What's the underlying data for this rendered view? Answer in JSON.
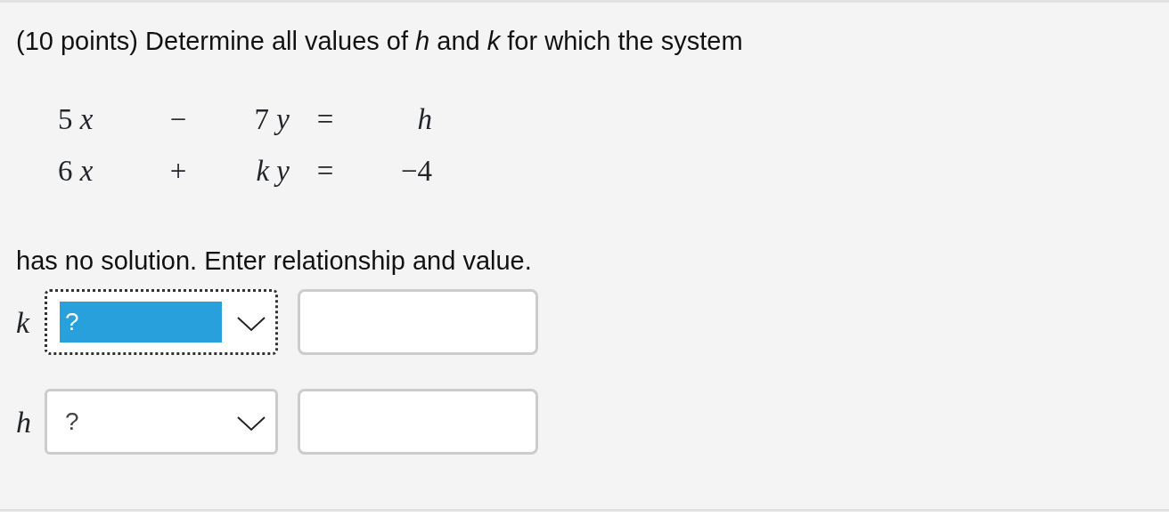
{
  "question": "(10 points) Determine all values of *h* and *k* for which the system",
  "equations": [
    {
      "cells": [
        "5 *x*",
        "−",
        "7 *y*",
        "=",
        "*h*"
      ]
    },
    {
      "cells": [
        "6 *x*",
        "+",
        "*k y*",
        "=",
        "−4"
      ]
    }
  ],
  "instruction": "has no solution. Enter relationship and value.",
  "answers": [
    {
      "variable": "k",
      "relation": "?",
      "focused": true
    },
    {
      "variable": "h",
      "relation": "?",
      "focused": false
    }
  ]
}
